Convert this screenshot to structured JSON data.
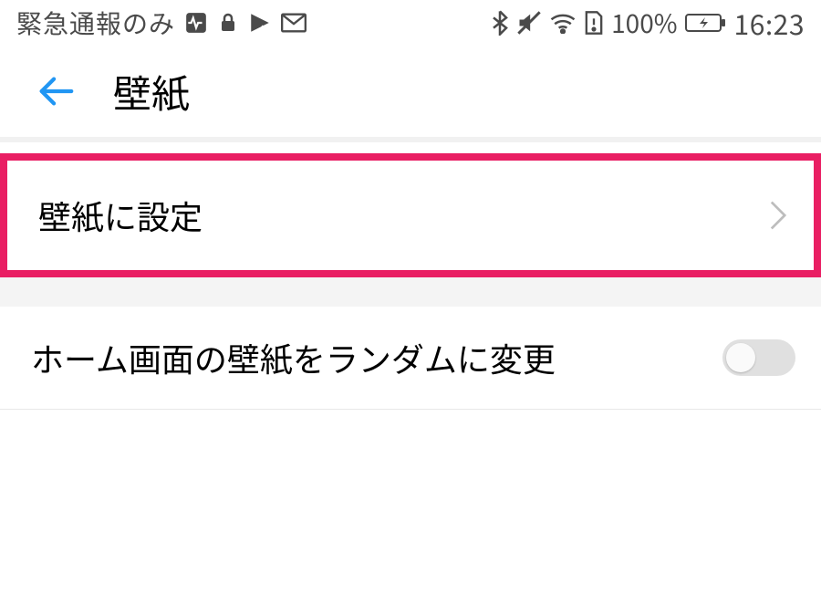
{
  "status": {
    "carrier": "緊急通報のみ",
    "battery_percent": "100%",
    "time": "16:23"
  },
  "header": {
    "title": "壁紙"
  },
  "rows": {
    "set_wallpaper": "壁紙に設定",
    "random_change": "ホーム画面の壁紙をランダムに変更"
  }
}
